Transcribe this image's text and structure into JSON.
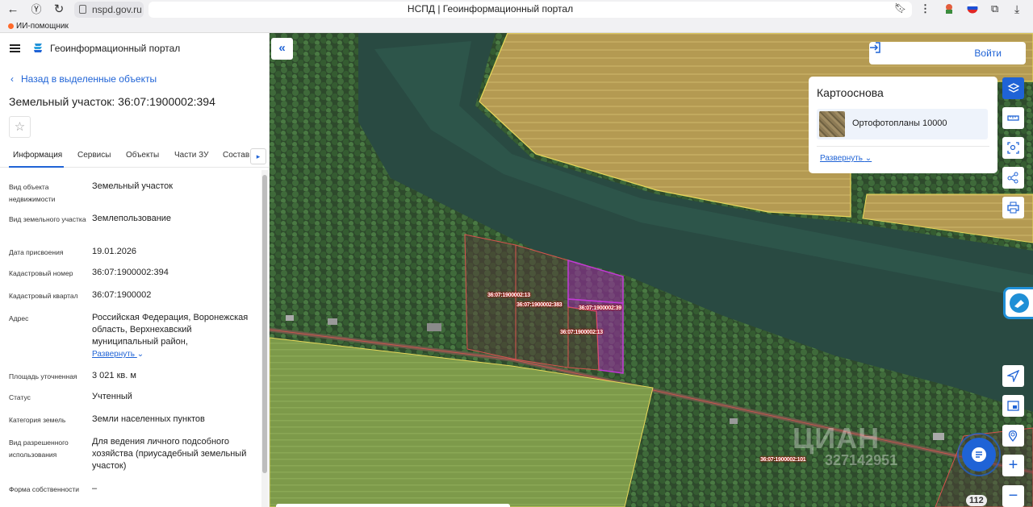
{
  "browser": {
    "url": "nspd.gov.ru",
    "page_title": "НСПД | Геоинформационный портал",
    "ai_assistant": "ИИ-помощник"
  },
  "panel": {
    "portal_title": "Геоинформационный портал",
    "back_link": "Назад в выделенные объекты",
    "object_title": "Земельный участок: 36:07:1900002:394",
    "tabs": [
      "Информация",
      "Сервисы",
      "Объекты",
      "Части ЗУ",
      "Состав"
    ],
    "active_tab": "Информация",
    "properties": [
      {
        "label": "Вид объекта недвижимости",
        "value": "Земельный участок"
      },
      {
        "label": "Вид земельного участка",
        "value": "Землепользование"
      },
      {
        "label": "Дата присвоения",
        "value": "19.01.2026"
      },
      {
        "label": "Кадастровый номер",
        "value": "36:07:1900002:394"
      },
      {
        "label": "Кадастровый квартал",
        "value": "36:07:1900002"
      },
      {
        "label": "Адрес",
        "value": "Российская Федерация, Воронежская область, Верхнехавский муниципальный район,"
      },
      {
        "label": "Площадь уточненная",
        "value": "3 021 кв. м"
      },
      {
        "label": "Статус",
        "value": "Учтенный"
      },
      {
        "label": "Категория земель",
        "value": "Земли населенных пунктов"
      },
      {
        "label": "Вид разрешенного использования",
        "value": "Для ведения личного подсобного хозяйства (приусадебный земельный участок)"
      },
      {
        "label": "Форма собственности",
        "value": "–"
      }
    ],
    "expand_label": "Развернуть"
  },
  "map": {
    "login_label": "Войти",
    "basemap_title": "Картооснова",
    "basemap_option": "Ортофотопланы 10000",
    "basemap_expand": "Развернуть",
    "road_number": "112",
    "watermark": "ЦИАН",
    "watermark_id": "327142951",
    "parcel_labels": [
      "36:07:1900002:13",
      "36:07:1900002:383",
      "36:07:1900002:39",
      "36:07:1900002:13",
      "36:07:1900002:101"
    ],
    "colors": {
      "accent": "#1f63d6",
      "parcel_outline": "#d9534f",
      "selected_parcel": "#c23ad6",
      "field_outline": "#e8d85a"
    }
  }
}
